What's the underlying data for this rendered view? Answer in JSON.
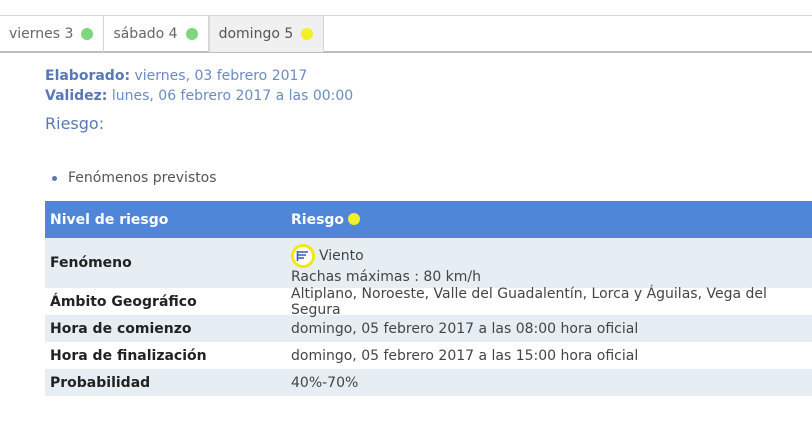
{
  "tabs": [
    {
      "label": "viernes 3",
      "dot_color": "#7ed67e",
      "active": false
    },
    {
      "label": "sábado 4",
      "dot_color": "#7ed67e",
      "active": false
    },
    {
      "label": "domingo 5",
      "dot_color": "#f2ee2a",
      "active": true
    }
  ],
  "meta": {
    "elaborado_label": "Elaborado:",
    "elaborado_value": "viernes, 03 febrero 2017",
    "validez_label": "Validez:",
    "validez_value": "lunes, 06 febrero 2017 a las 00:00"
  },
  "riesgo_title": "Riesgo:",
  "bullet": "Fenómenos previstos",
  "table": {
    "header": {
      "c1": "Nivel de riesgo",
      "c2": "Riesgo",
      "risk_color": "#f2ee2a"
    },
    "fenomeno": {
      "label": "Fenómeno",
      "icon": "wind-icon",
      "name": "Viento",
      "detail": "Rachas máximas : 80 km/h"
    },
    "rows": [
      {
        "label": "Ámbito Geográfico",
        "value": "Altiplano, Noroeste, Valle del Guadalentín, Lorca y Águilas, Vega del Segura"
      },
      {
        "label": "Hora de comienzo",
        "value": "domingo, 05 febrero 2017 a las 08:00 hora oficial"
      },
      {
        "label": "Hora de finalización",
        "value": "domingo, 05 febrero 2017 a las 15:00 hora oficial"
      },
      {
        "label": "Probabilidad",
        "value": "40%-70%"
      }
    ]
  },
  "colors": {
    "accent": "#4f86d8",
    "text_blue": "#5878b5",
    "row_alt": "#e6eef4"
  }
}
